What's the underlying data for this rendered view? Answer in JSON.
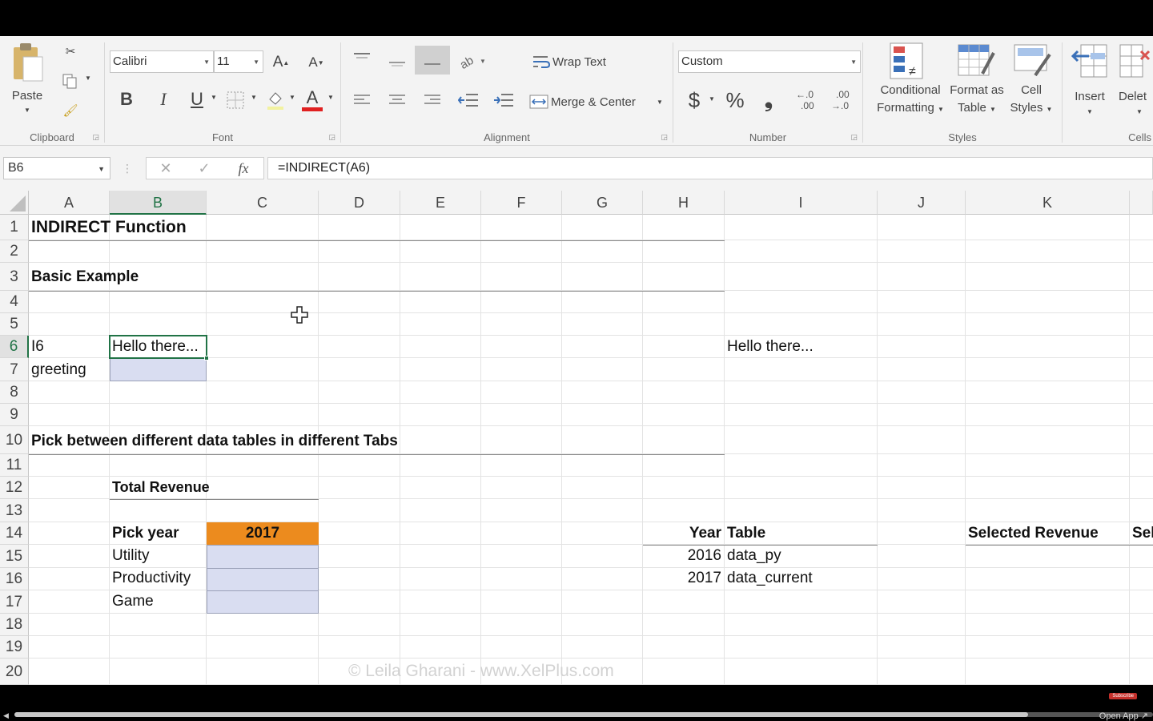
{
  "ribbon": {
    "clipboard": {
      "paste": "Paste",
      "label": "Clipboard"
    },
    "font": {
      "name": "Calibri",
      "size": "11",
      "label": "Font",
      "bold": "B",
      "italic": "I",
      "underline": "U",
      "font_color": "#e02020"
    },
    "alignment": {
      "wrap_text": "Wrap Text",
      "merge_center": "Merge & Center",
      "label": "Alignment"
    },
    "number": {
      "format": "Custom",
      "currency": "$",
      "percent": "%",
      "comma": "❟",
      "label": "Number"
    },
    "styles": {
      "conditional_1": "Conditional",
      "conditional_2": "Formatting",
      "format_table_1": "Format as",
      "format_table_2": "Table",
      "cell_styles_1": "Cell",
      "cell_styles_2": "Styles",
      "label": "Styles"
    },
    "cells": {
      "insert": "Insert",
      "delete": "Delet",
      "label": "Cells"
    }
  },
  "formula_bar": {
    "name_box": "B6",
    "formula": "=INDIRECT(A6)"
  },
  "columns": [
    "A",
    "B",
    "C",
    "D",
    "E",
    "F",
    "G",
    "H",
    "I",
    "J",
    "K"
  ],
  "rows": [
    "1",
    "2",
    "3",
    "4",
    "5",
    "6",
    "7",
    "8",
    "9",
    "10",
    "11",
    "12",
    "13",
    "14",
    "15",
    "16",
    "17",
    "18",
    "19",
    "20"
  ],
  "cells": {
    "A1": "INDIRECT Function",
    "A3": "Basic Example",
    "A6": "I6",
    "A7": "greeting",
    "B6": "Hello there...",
    "I6": "Hello there...",
    "A10": "Pick between different data tables in different Tabs",
    "B12": "Total Revenue",
    "B14": "Pick year",
    "C14": "2017",
    "B15": "Utility",
    "B16": "Productivity",
    "B17": "Game",
    "H14": "Year",
    "I14": "Table",
    "H15": "2016",
    "I15": "data_py",
    "H16": "2017",
    "I16": "data_current",
    "K14": "Selected Revenue",
    "L14": "Sel"
  },
  "watermark": "© Leila Gharani - www.XelPlus.com",
  "player": {
    "open_app": "Open App ↗",
    "subscribe": "Subscribe",
    "progress": 0.89
  },
  "colors": {
    "accent": "#217346",
    "orange": "#ec8b1e",
    "blue_fill": "#d9ddf1"
  }
}
